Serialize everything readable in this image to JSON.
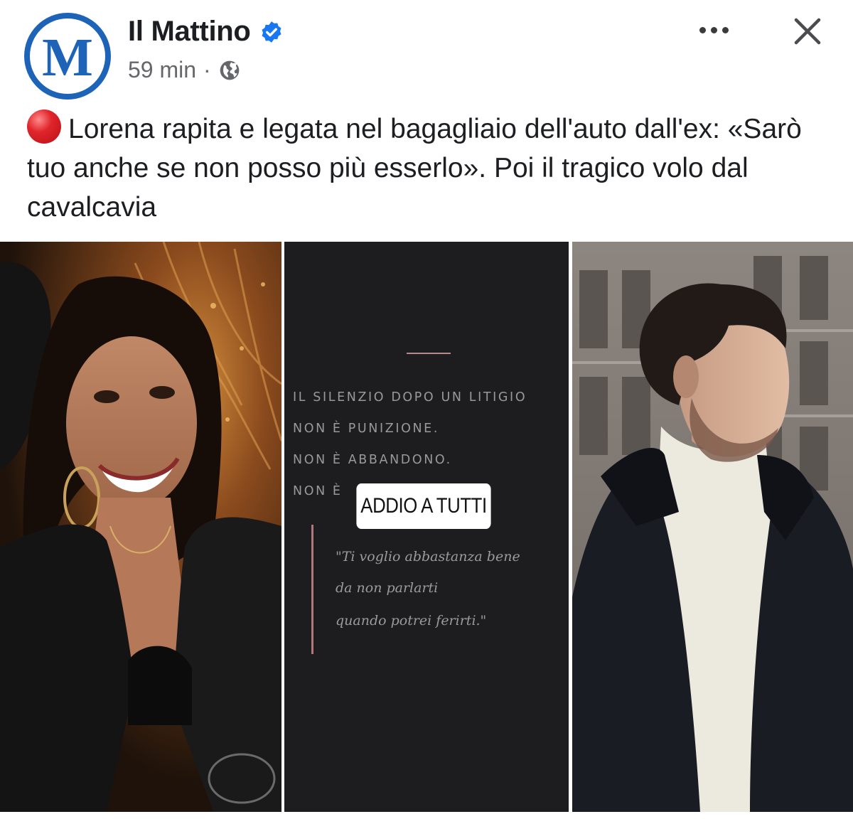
{
  "post": {
    "author": {
      "name": "Il Mattino",
      "avatar_letter": "M",
      "verified": true
    },
    "meta": {
      "time": "59 min",
      "separator": "·",
      "audience_icon": "globe-icon"
    },
    "actions": {
      "more_icon": "more-horizontal-icon",
      "close_icon": "close-icon"
    },
    "text": {
      "emoji": "red-circle-icon",
      "body": "Lorena rapita e legata nel bagagliaio dell'auto dall'ex: «Sarò tuo anche se non posso più esserlo». Poi il tragico volo dal cavalcavia"
    }
  },
  "collage": {
    "left_photo": "woman smiling at night",
    "right_photo": "man in turtleneck and dark coat",
    "story": {
      "lines": [
        "IL SILENZIO DOPO UN LITIGIO",
        "NON È PUNIZIONE.",
        "NON È ABBANDONO.",
        "NON È"
      ],
      "sticker": "ADDIO A TUTTI",
      "quote": [
        "\"Ti voglio abbastanza bene",
        "da non parlarti",
        "quando potrei ferirti.\""
      ]
    }
  },
  "colors": {
    "brand_blue": "#1d63b8",
    "verified_blue": "#1877f2",
    "secondary_text": "#65676b",
    "story_background": "#1d1c1e",
    "story_accent": "#b2767d"
  }
}
